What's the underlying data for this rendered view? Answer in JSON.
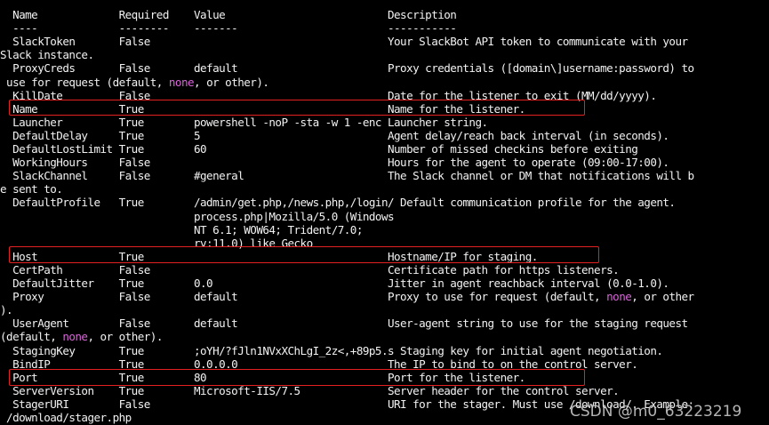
{
  "colors": {
    "background": "#000000",
    "text": "#f2f2f2",
    "keyword": "#d866d8",
    "highlight_box": "#e32121"
  },
  "terminal_lines": [
    [
      {
        "t": "  Name             Required    Value                          Description"
      }
    ],
    [
      {
        "t": "  ----             --------    -------                        -----------"
      }
    ],
    [
      {
        "t": "  SlackToken       False                                      Your SlackBot API token to communicate with your"
      }
    ],
    [
      {
        "t": "Slack instance."
      }
    ],
    [
      {
        "t": "  ProxyCreds       False       default                        Proxy credentials ([domain\\]username:password) to"
      }
    ],
    [
      {
        "t": " use for request (default, "
      },
      {
        "t": "none",
        "c": "keyword"
      },
      {
        "t": ", or other)."
      }
    ],
    [
      {
        "t": "  KillDate         False                                      Date for the listener to exit (MM/dd/yyyy)."
      }
    ],
    [
      {
        "t": "  Name             True                                       Name for the listener."
      }
    ],
    [
      {
        "t": "  Launcher         True        powershell -noP -sta -w 1 -enc Launcher string."
      }
    ],
    [
      {
        "t": "  DefaultDelay     True        5                              Agent delay/reach back interval (in seconds)."
      }
    ],
    [
      {
        "t": "  DefaultLostLimit True        60                             Number of missed checkins before exiting"
      }
    ],
    [
      {
        "t": "  WorkingHours     False                                      Hours for the agent to operate (09:00-17:00)."
      }
    ],
    [
      {
        "t": "  SlackChannel     False       #general                       The Slack channel or DM that notifications will b"
      }
    ],
    [
      {
        "t": "e sent to."
      }
    ],
    [
      {
        "t": "  DefaultProfile   True        /admin/get.php,/news.php,/login/ Default communication profile for the agent."
      }
    ],
    [
      {
        "t": "                               process.php|Mozilla/5.0 (Windows"
      }
    ],
    [
      {
        "t": "                               NT 6.1; WOW64; Trident/7.0;"
      }
    ],
    [
      {
        "t": "                               rv:11.0) like Gecko"
      }
    ],
    [
      {
        "t": "  Host             True                                       Hostname/IP for staging."
      }
    ],
    [
      {
        "t": "  CertPath         False                                      Certificate path for https listeners."
      }
    ],
    [
      {
        "t": "  DefaultJitter    True        0.0                            Jitter in agent reachback interval (0.0-1.0)."
      }
    ],
    [
      {
        "t": "  Proxy            False       default                        Proxy to use for request (default, "
      },
      {
        "t": "none",
        "c": "keyword"
      },
      {
        "t": ", or other"
      }
    ],
    [
      {
        "t": ")."
      }
    ],
    [
      {
        "t": "  UserAgent        False       default                        User-agent string to use for the staging request"
      }
    ],
    [
      {
        "t": "(default, "
      },
      {
        "t": "none",
        "c": "keyword"
      },
      {
        "t": ", or other)."
      }
    ],
    [
      {
        "t": "  StagingKey       True        ;oYH/?fJln1NVxXChLgI_2z<,+89p5.s Staging key for initial agent negotiation."
      }
    ],
    [
      {
        "t": "  BindIP           True        0.0.0.0                        The IP to bind to on the control server."
      }
    ],
    [
      {
        "t": "  Port             True        80                             Port for the listener."
      }
    ],
    [
      {
        "t": "  ServerVersion    True        Microsoft-IIS/7.5              Server header for the control server."
      }
    ],
    [
      {
        "t": "  StagerURI        False                                      URI for the stager. Must use /download/. Example:"
      }
    ],
    [
      {
        "t": " /download/stager.php"
      }
    ]
  ],
  "highlighted_rows": [
    "Name",
    "Host",
    "Port"
  ],
  "watermark": "CSDN @m0_63223219"
}
